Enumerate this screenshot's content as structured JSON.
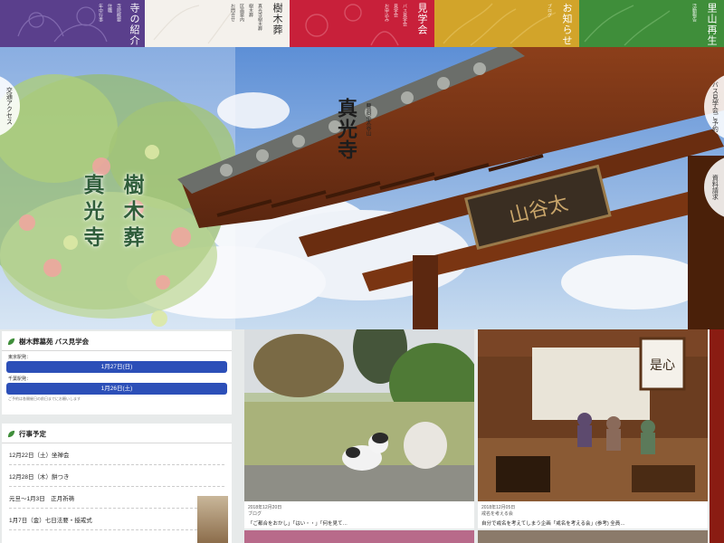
{
  "top_nav": {
    "temple": {
      "label": "寺の紹介",
      "sub": [
        "寺院概要",
        "住職",
        "年中行事"
      ]
    },
    "tree": {
      "label": "樹木葬",
      "sub": [
        "真光寺樹木葬",
        "樹木葬",
        "区画案内",
        "お問合せ"
      ]
    },
    "tour": {
      "label": "見学会",
      "sub": [
        "バス見学会",
        "見学会",
        "お申込み"
      ]
    },
    "news": {
      "label": "お知らせ",
      "sub": [
        "ブログ"
      ]
    },
    "satoyama": {
      "label": "里山再生",
      "sub": [
        "活動報告"
      ]
    }
  },
  "hero": {
    "access_tab": "交通アクセス",
    "bus_tab": "バス見学会ご予約",
    "doc_tab": "資料請求",
    "title_col1": "樹木葬",
    "title_col2": "真光寺",
    "temple_main": "真光寺",
    "temple_sub": "曹洞宗太谷山"
  },
  "bus_tour": {
    "title": "樹木葬墓苑 バス見学会",
    "departures": [
      {
        "label": "東京駅発：",
        "date": "1月27日(日)"
      },
      {
        "label": "千葉駅発：",
        "date": "1月26日(土)"
      }
    ],
    "note": "ご予約は各開催日の前日までにお願いします"
  },
  "events": {
    "title": "行事予定",
    "items": [
      "12月22日（土）坐禅会",
      "12月28日（木）餅つき",
      "元旦～1月3日　正月祈祷",
      "1月7日（金）七日法要・授戒式"
    ]
  },
  "cards": [
    {
      "date": "2018年12月20日",
      "tag": "ブログ",
      "text": "「ご都合をおかし」「はい・・」「何を見て…"
    },
    {
      "date": "2018年12月05日",
      "tag": "戒名を考える会",
      "text": "自分で戒名を考えてしまう企画「戒名を考える会」(参考) 全員…"
    }
  ],
  "colors": {
    "temple": "#5a3f8c",
    "tree": "#f4f1ec",
    "tour": "#c8203a",
    "news": "#d2a42a",
    "satoyama": "#3f8e3a",
    "bus_button": "#2c4fb8"
  }
}
